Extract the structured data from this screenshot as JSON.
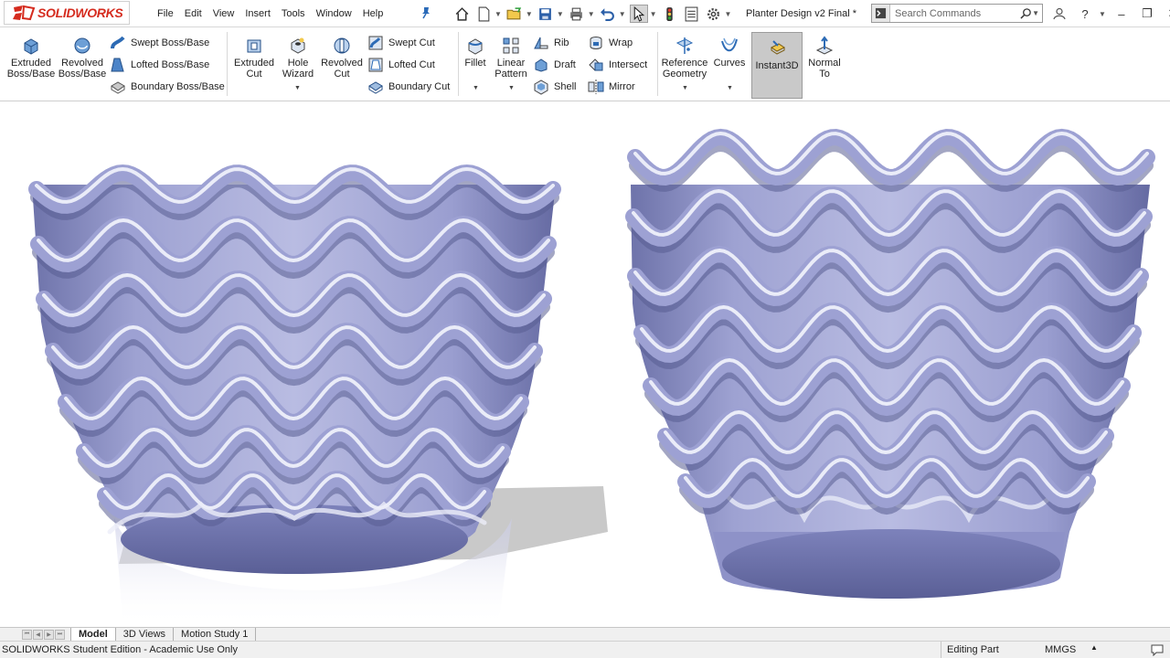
{
  "app": {
    "brand_prefix": "3DS",
    "brand": "SOLIDWORKS",
    "document_title": "Planter Design v2 Final *"
  },
  "menu": [
    "File",
    "Edit",
    "View",
    "Insert",
    "Tools",
    "Window",
    "Help"
  ],
  "search": {
    "placeholder": "Search Commands"
  },
  "ribbon": {
    "extruded_boss": "Extruded Boss/Base",
    "revolved_boss": "Revolved Boss/Base",
    "swept_boss": "Swept Boss/Base",
    "lofted_boss": "Lofted Boss/Base",
    "boundary_boss": "Boundary Boss/Base",
    "extruded_cut": "Extruded Cut",
    "hole_wizard": "Hole Wizard",
    "revolved_cut": "Revolved Cut",
    "swept_cut": "Swept Cut",
    "lofted_cut": "Lofted Cut",
    "boundary_cut": "Boundary Cut",
    "fillet": "Fillet",
    "linear_pattern": "Linear Pattern",
    "rib": "Rib",
    "draft": "Draft",
    "shell": "Shell",
    "wrap": "Wrap",
    "intersect": "Intersect",
    "mirror": "Mirror",
    "reference_geometry": "Reference Geometry",
    "curves": "Curves",
    "instant3d": "Instant3D",
    "normal_to": "Normal To"
  },
  "tabs": [
    "Model",
    "3D Views",
    "Motion Study 1"
  ],
  "status": {
    "edition": "SOLIDWORKS Student Edition - Academic Use Only",
    "mode": "Editing Part",
    "units": "MMGS"
  },
  "colors": {
    "brand_red": "#d52b1e",
    "model_base": "#8a8fc4",
    "model_highlight": "#e4e6f6",
    "model_shadow": "#4d5184"
  }
}
